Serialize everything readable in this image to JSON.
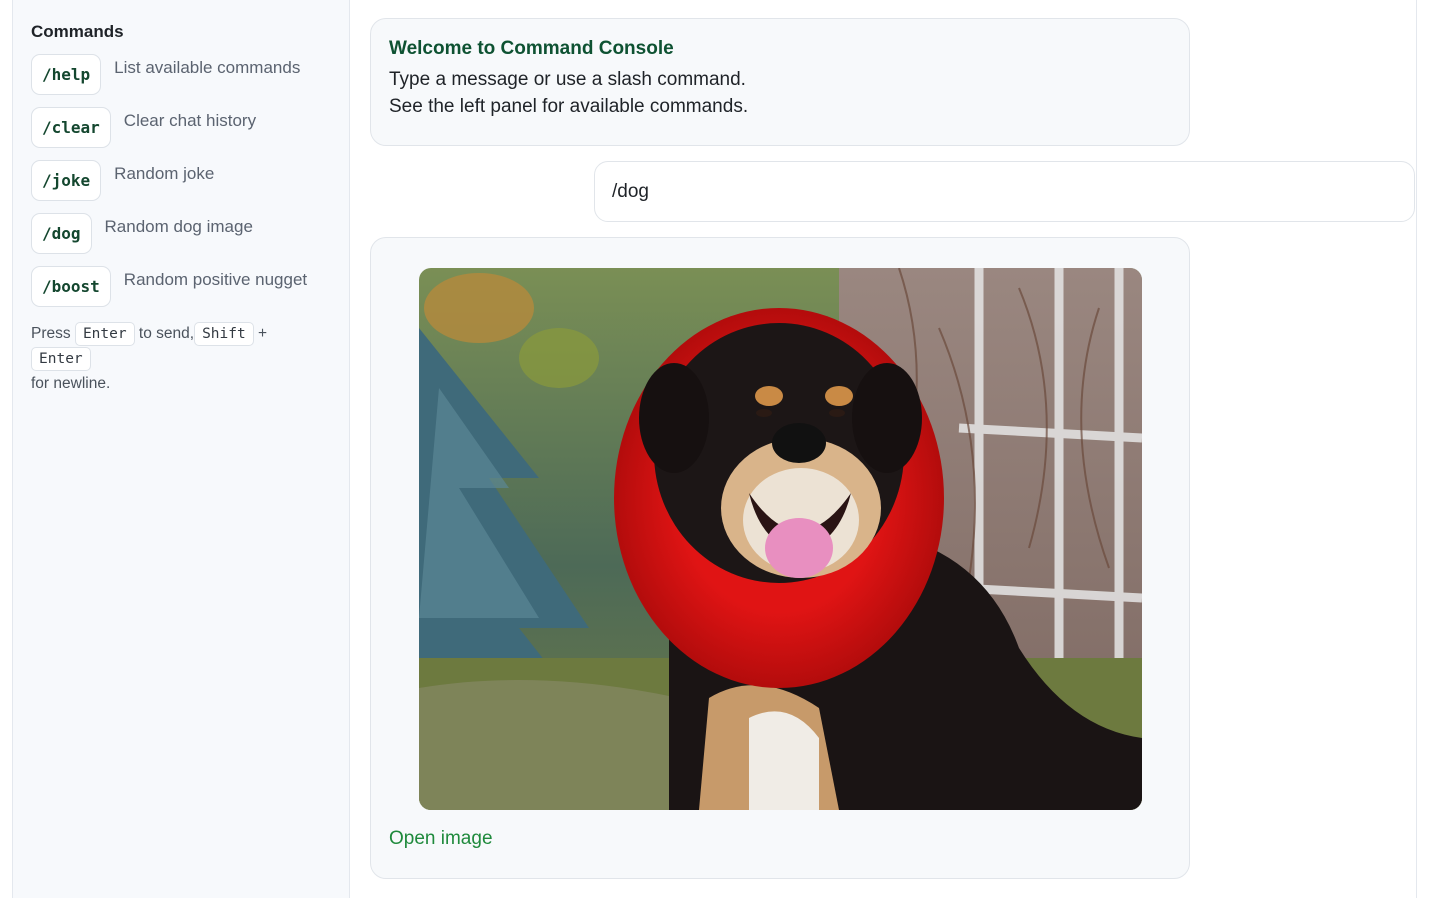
{
  "sidebar": {
    "title": "Commands",
    "commands": [
      {
        "cmd": "/help",
        "desc": "List available commands"
      },
      {
        "cmd": "/clear",
        "desc": "Clear chat history"
      },
      {
        "cmd": "/joke",
        "desc": "Random joke"
      },
      {
        "cmd": "/dog",
        "desc": "Random dog image"
      },
      {
        "cmd": "/boost",
        "desc": "Random positive nugget"
      }
    ],
    "hint": {
      "press": "Press",
      "key_enter": "Enter",
      "to_send": "to send,",
      "key_shift": "Shift",
      "plus": "+",
      "key_enter2": "Enter",
      "newline": "for newline."
    }
  },
  "chat": {
    "welcome": {
      "title": "Welcome to Command Console",
      "line1": "Type a message or use a slash command.",
      "line2": "See the left panel for available commands."
    },
    "user_message": "/dog",
    "image_reply": {
      "link_label": "Open image"
    }
  },
  "colors": {
    "accent_green": "#0e5232",
    "link_green": "#1f8a3c",
    "panel_bg": "#f7f9fc"
  }
}
